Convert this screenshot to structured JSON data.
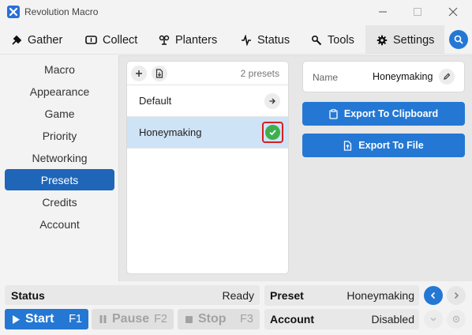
{
  "window": {
    "title": "Revolution Macro"
  },
  "tabs": [
    {
      "label": "Gather",
      "icon": "gather-icon"
    },
    {
      "label": "Collect",
      "icon": "collect-icon"
    },
    {
      "label": "Planters",
      "icon": "planters-icon"
    },
    {
      "label": "Status",
      "icon": "status-icon"
    },
    {
      "label": "Tools",
      "icon": "tools-icon"
    },
    {
      "label": "Settings",
      "icon": "gear-icon",
      "active": true
    }
  ],
  "sidebar": {
    "items": [
      {
        "label": "Macro"
      },
      {
        "label": "Appearance"
      },
      {
        "label": "Game"
      },
      {
        "label": "Priority"
      },
      {
        "label": "Networking"
      },
      {
        "label": "Presets",
        "active": true
      },
      {
        "label": "Credits"
      },
      {
        "label": "Account"
      }
    ]
  },
  "presets": {
    "count_label": "2 presets",
    "items": [
      {
        "name": "Default",
        "action_icon": "arrow-right-icon"
      },
      {
        "name": "Honeymaking",
        "selected": true,
        "action_icon": "check-icon"
      }
    ]
  },
  "details": {
    "name_label": "Name",
    "name_value": "Honeymaking",
    "export_clipboard_label": "Export To Clipboard",
    "export_file_label": "Export To File"
  },
  "status_bar": {
    "status_label": "Status",
    "status_value": "Ready",
    "preset_label": "Preset",
    "preset_value": "Honeymaking",
    "account_label": "Account",
    "account_value": "Disabled",
    "start_label": "Start",
    "start_key": "F1",
    "pause_label": "Pause",
    "pause_key": "F2",
    "stop_label": "Stop",
    "stop_key": "F3"
  },
  "colors": {
    "accent": "#2478d4",
    "sidebar_active": "#1f66b8",
    "selected_row": "#cfe3f6",
    "success": "#3fae4f",
    "highlight_border": "#d62020"
  }
}
